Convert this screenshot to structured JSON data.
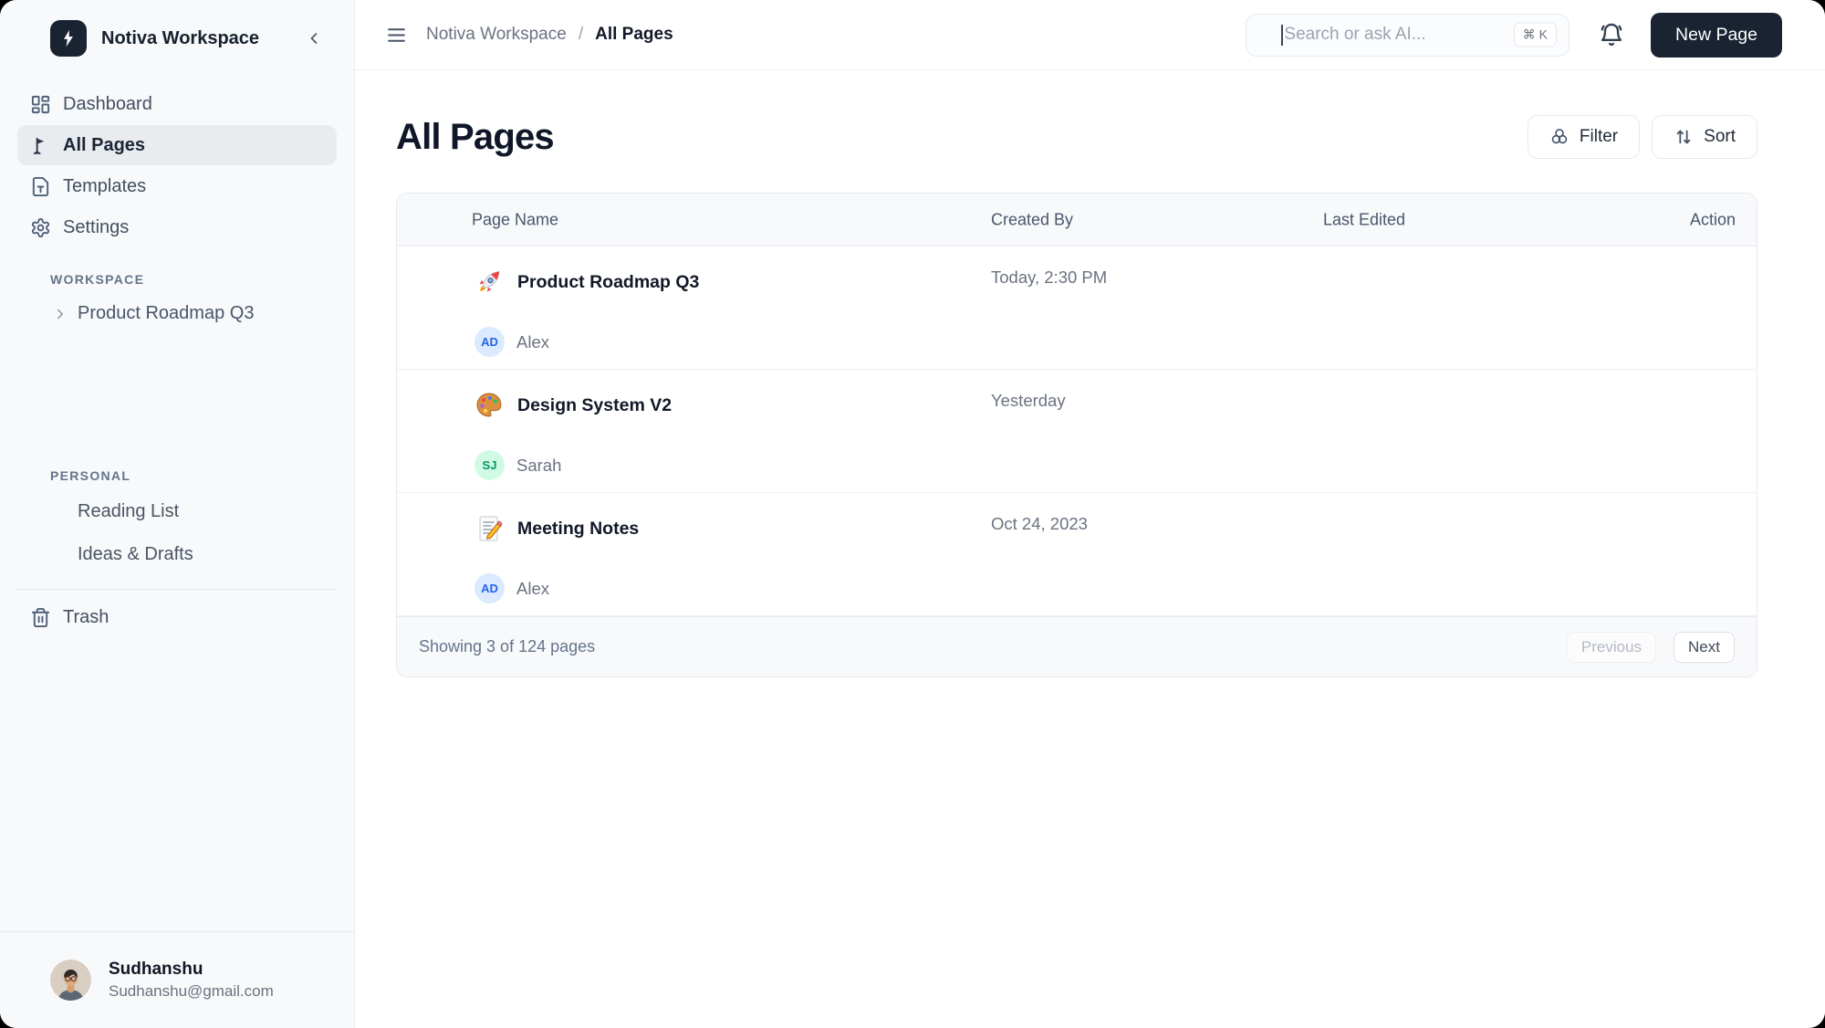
{
  "sidebar": {
    "workspace_name": "Notiva Workspace",
    "nav": [
      {
        "label": "Dashboard",
        "icon": "dashboard-icon",
        "active": false
      },
      {
        "label": "All Pages",
        "icon": "flag-icon",
        "active": true
      },
      {
        "label": "Templates",
        "icon": "template-file-icon",
        "active": false
      },
      {
        "label": "Settings",
        "icon": "gear-icon",
        "active": false
      }
    ],
    "workspace_section": {
      "title": "WORKSPACE",
      "items": [
        {
          "label": "Product Roadmap Q3",
          "icon": "chevron-right-icon"
        }
      ]
    },
    "personal_section": {
      "title": "PERSONAL",
      "items": [
        {
          "label": "Reading List"
        },
        {
          "label": "Ideas & Drafts"
        }
      ]
    },
    "trash_label": "Trash",
    "user": {
      "name": "Sudhanshu",
      "email": "Sudhanshu@gmail.com"
    }
  },
  "topbar": {
    "breadcrumb": {
      "root": "Notiva Workspace",
      "separator": "/",
      "current": "All Pages"
    },
    "search": {
      "placeholder": "Search or ask AI...",
      "shortcut": "⌘ K"
    },
    "notifications_icon": "bell-icon",
    "new_page_label": "New Page"
  },
  "main": {
    "title": "All Pages",
    "filter_label": "Filter",
    "sort_label": "Sort",
    "table": {
      "columns": [
        "Page Name",
        "Created By",
        "Last Edited",
        "Action"
      ],
      "rows": [
        {
          "icon": "rocket-icon",
          "name": "Product Roadmap Q3",
          "created": "Today, 2:30 PM",
          "creator": {
            "initials": "AD",
            "name": "Alex",
            "color": "blue"
          }
        },
        {
          "icon": "palette-icon",
          "name": "Design System V2",
          "created": "Yesterday",
          "creator": {
            "initials": "SJ",
            "name": "Sarah",
            "color": "green"
          }
        },
        {
          "icon": "memo-icon",
          "name": "Meeting Notes",
          "created": "Oct 24, 2023",
          "creator": {
            "initials": "AD",
            "name": "Alex",
            "color": "blue"
          }
        }
      ],
      "footer": {
        "summary": "Showing 3 of 124 pages",
        "previous_label": "Previous",
        "next_label": "Next"
      }
    }
  },
  "colors": {
    "brand_dark": "#1a2332",
    "sidebar_bg": "#f8f9fa",
    "active_item_bg": "#e9ebef",
    "border": "#e7e9ee",
    "text_primary": "#111827",
    "text_secondary": "#6b7280",
    "muted": "#9ca3af",
    "avatar_blue_bg": "#dbeafe",
    "avatar_blue_text": "#2563eb",
    "avatar_green_bg": "#d1fae5",
    "avatar_green_text": "#059669"
  }
}
